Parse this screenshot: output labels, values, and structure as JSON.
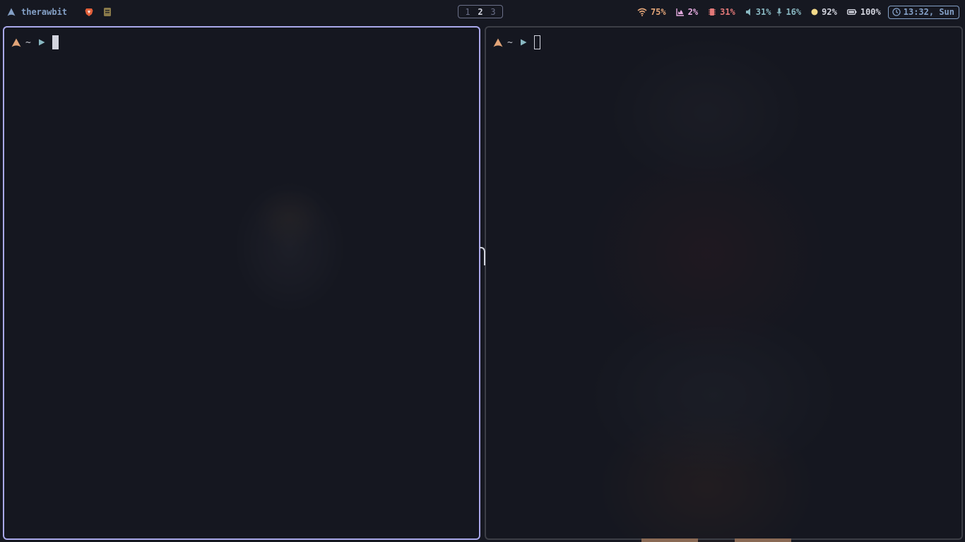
{
  "topbar": {
    "hostname": "therawbit",
    "workspaces": [
      "1",
      "2",
      "3"
    ],
    "active_workspace": "2",
    "modules": {
      "wifi": "75%",
      "cpu": "2%",
      "memory": "31%",
      "volume": "31%",
      "mic": "16%",
      "brightness": "92%",
      "battery": "100%"
    },
    "clock": "13:32, Sun"
  },
  "terminals": {
    "left": {
      "prompt_dir": "~",
      "focused": true
    },
    "right": {
      "prompt_dir": "~",
      "focused": false
    }
  },
  "colors": {
    "accent": "#84a0c6",
    "focused_border": "#a9a8ea",
    "wifi": "#e2a478",
    "cpu": "#e4aadf",
    "memory": "#e27878",
    "volume": "#89b8c2",
    "brightness": "#f2d98a",
    "arch_prompt": "#e2a478",
    "prompt_arrow": "#89b8c2"
  },
  "icons": {
    "wifi": "wifi-icon",
    "cpu": "cpu-chart-icon",
    "memory": "memory-chip-icon",
    "volume": "volume-icon",
    "mic": "microphone-icon",
    "brightness": "brightness-icon",
    "battery": "battery-icon",
    "clock": "clock-icon"
  }
}
